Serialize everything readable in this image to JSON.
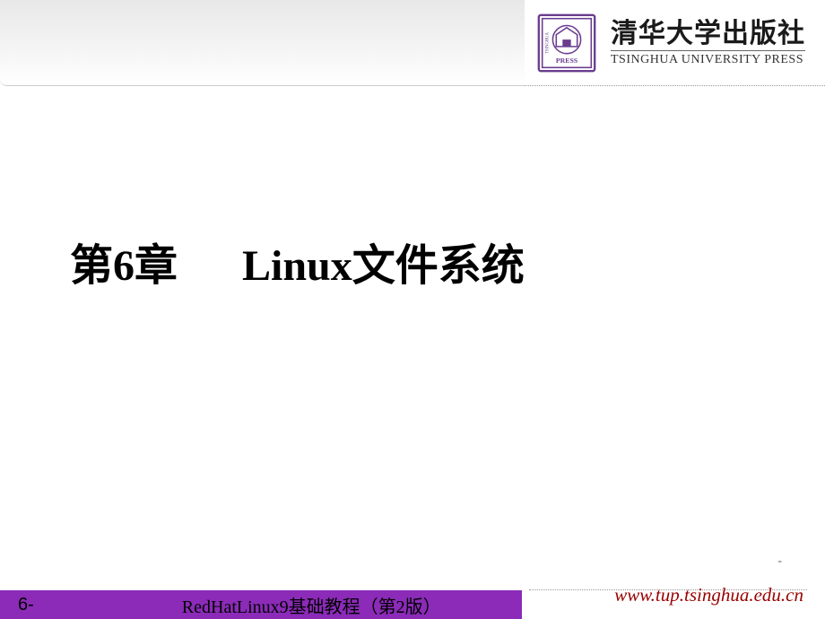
{
  "publisher": {
    "name_cn": "清华大学出版社",
    "name_en": "TSINGHUA UNIVERSITY PRESS"
  },
  "chapter": {
    "title": "第6章      Linux文件系统"
  },
  "footer": {
    "page_number": "6-",
    "book_title": "RedHatLinux9基础教程（第2版）",
    "url": "www.tup.tsinghua.edu.cn"
  }
}
